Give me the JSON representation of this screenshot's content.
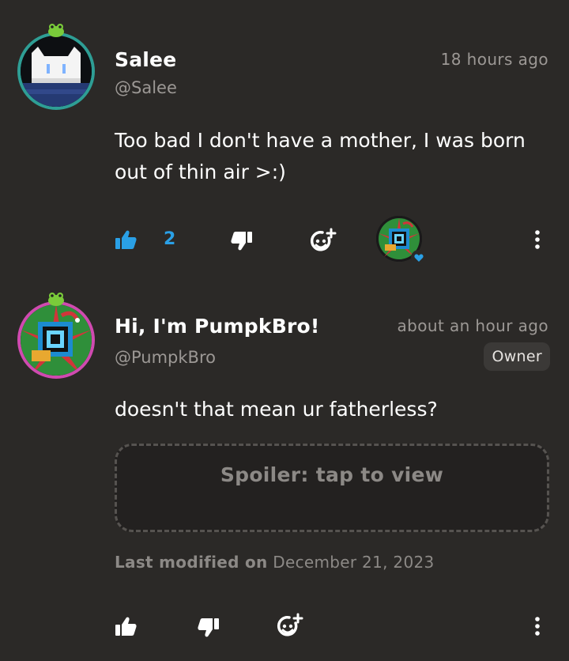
{
  "comments": [
    {
      "name": "Salee",
      "handle": "@Salee",
      "time": "18 hours ago",
      "text": "Too bad I don't have a mother, I was born out of thin air >:)",
      "like_count": "2"
    },
    {
      "name": "Hi, I'm PumpkBro!",
      "handle": "@PumpkBro",
      "time": "about an hour ago",
      "badge": "Owner",
      "text": "doesn't that mean ur fatherless?",
      "spoiler_label": "Spoiler: tap to view",
      "modified_label": "Last modified on",
      "modified_date": "December 21, 2023"
    }
  ],
  "colors": {
    "background": "#2b2927",
    "accent": "#2aa0e6",
    "muted": "#9c9895"
  },
  "icons": [
    "thumbs-up-icon",
    "thumbs-down-icon",
    "add-reaction-icon",
    "more-vertical-icon",
    "heart-icon"
  ]
}
